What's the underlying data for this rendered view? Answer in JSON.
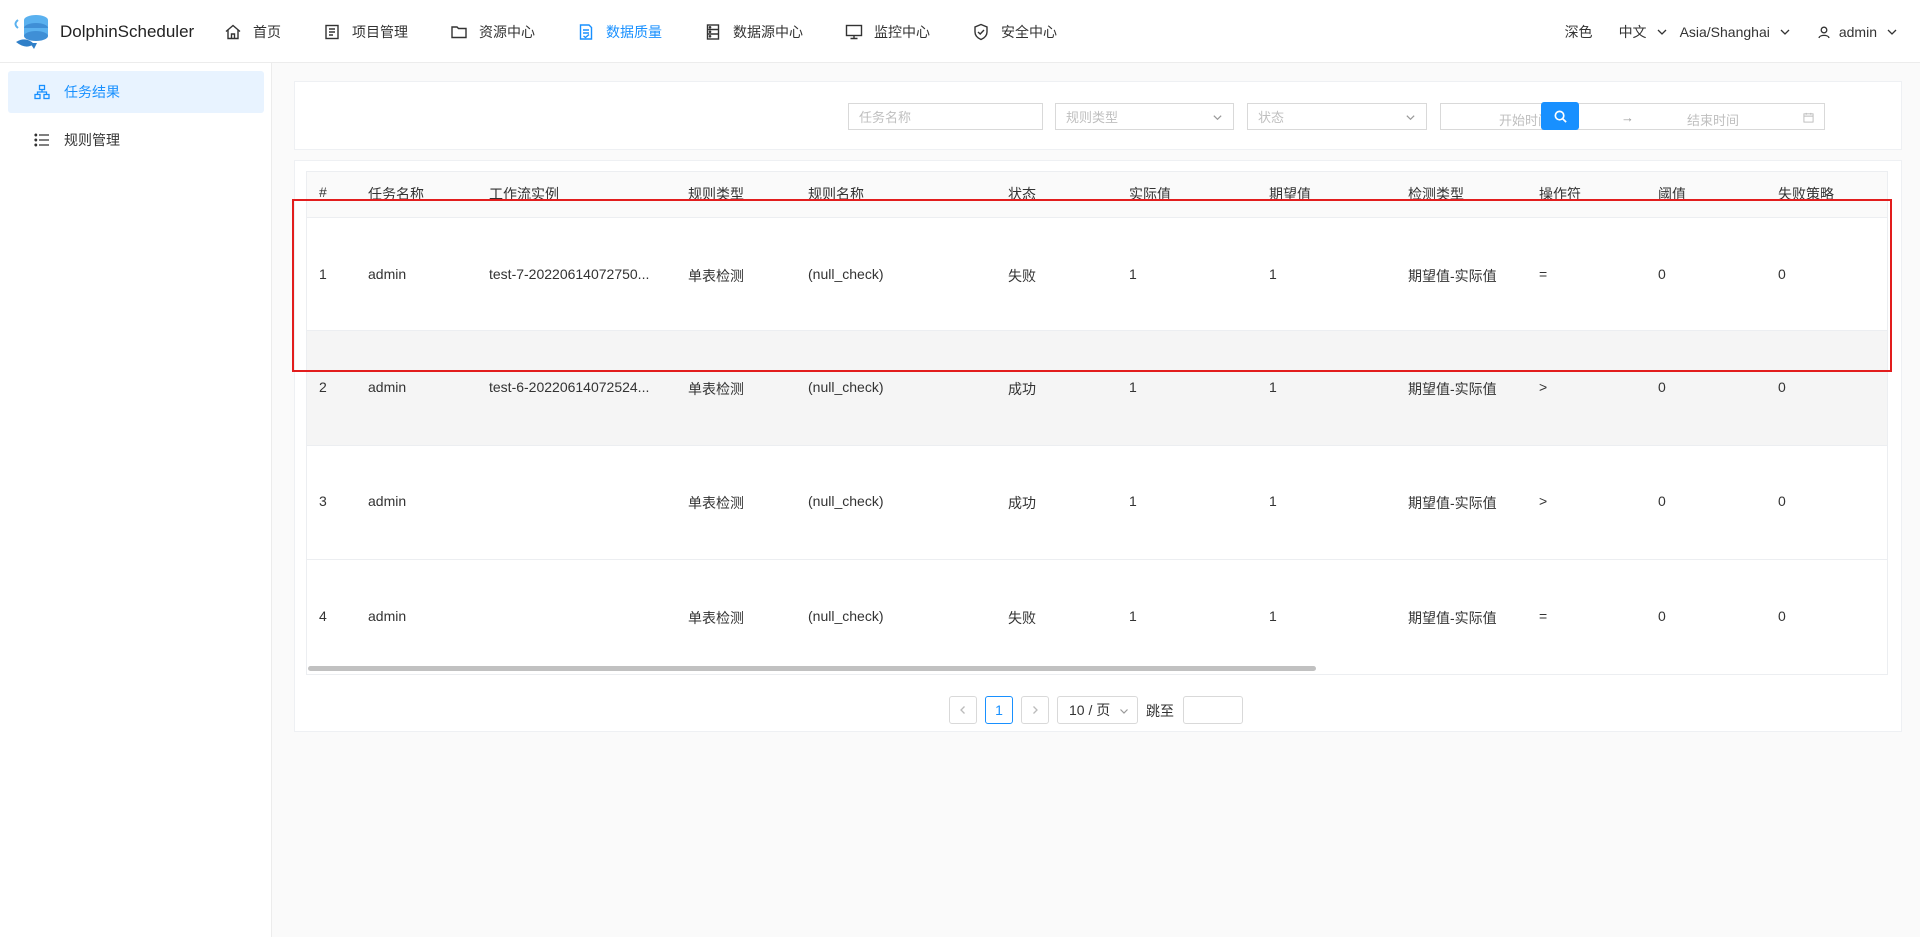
{
  "brand": {
    "name": "DolphinScheduler"
  },
  "nav": {
    "items": [
      {
        "label": "首页",
        "icon": "home-icon"
      },
      {
        "label": "项目管理",
        "icon": "project-icon"
      },
      {
        "label": "资源中心",
        "icon": "folder-icon"
      },
      {
        "label": "数据质量",
        "icon": "data-quality-icon",
        "active": true
      },
      {
        "label": "数据源中心",
        "icon": "database-icon"
      },
      {
        "label": "监控中心",
        "icon": "monitor-icon"
      },
      {
        "label": "安全中心",
        "icon": "shield-icon"
      }
    ]
  },
  "header_right": {
    "theme": "深色",
    "language": "中文",
    "timezone": "Asia/Shanghai",
    "user": "admin"
  },
  "sidebar": {
    "items": [
      {
        "label": "任务结果",
        "icon": "task-result-icon",
        "active": true
      },
      {
        "label": "规则管理",
        "icon": "list-icon"
      }
    ]
  },
  "filters": {
    "task_name_placeholder": "任务名称",
    "rule_type_placeholder": "规则类型",
    "state_placeholder": "状态",
    "start_time_placeholder": "开始时间",
    "end_time_placeholder": "结束时间",
    "arrow": "→"
  },
  "table": {
    "columns": [
      "#",
      "任务名称",
      "工作流实例",
      "规则类型",
      "规则名称",
      "状态",
      "实际值",
      "期望值",
      "检测类型",
      "操作符",
      "阈值",
      "失败策略"
    ],
    "rows": [
      [
        "1",
        "admin",
        "test-7-20220614072750...",
        "单表检测",
        "(null_check)",
        "失败",
        "1",
        "1",
        "期望值-实际值",
        "=",
        "0",
        "0"
      ],
      [
        "2",
        "admin",
        "test-6-20220614072524...",
        "单表检测",
        "(null_check)",
        "成功",
        "1",
        "1",
        "期望值-实际值",
        ">",
        "0",
        "0"
      ],
      [
        "3",
        "admin",
        "",
        "单表检测",
        "(null_check)",
        "成功",
        "1",
        "1",
        "期望值-实际值",
        ">",
        "0",
        "0"
      ],
      [
        "4",
        "admin",
        "",
        "单表检测",
        "(null_check)",
        "失败",
        "1",
        "1",
        "期望值-实际值",
        "=",
        "0",
        "0"
      ]
    ]
  },
  "pagination": {
    "current_page": "1",
    "page_size": "10 / 页",
    "jump_label": "跳至"
  },
  "colors": {
    "accent": "#1890ff",
    "highlight_box": "#e21d1d"
  }
}
